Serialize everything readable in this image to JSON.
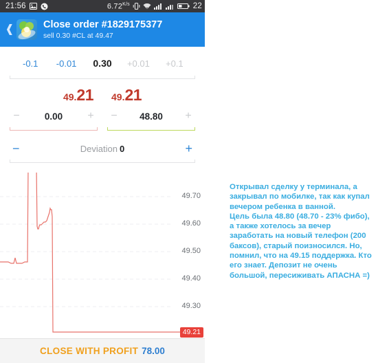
{
  "statusbar": {
    "time": "21:56",
    "icons_left": [
      "photo-icon",
      "phone-clock-icon"
    ],
    "data_rate": "6.72",
    "data_unit": "K/s",
    "icons_right": [
      "vibrate-icon",
      "wifi-icon",
      "signal-icon",
      "signal2-icon",
      "battery-icon"
    ],
    "battery_percent": "22"
  },
  "appbar": {
    "back_icon": "chevron-left-icon",
    "logo_icon": "app-logo-icon",
    "title": "Close order #1829175377",
    "subtitle": "sell 0.30 #CL at 49.47"
  },
  "volume_row": {
    "minus_big": "-0.1",
    "minus_small": "-0.01",
    "value": "0.30",
    "plus_small": "+0.01",
    "plus_big": "+0.1"
  },
  "prices": {
    "bid_int": "49.",
    "bid_dec": "21",
    "ask_int": "49.",
    "ask_dec": "21",
    "color": "#c0392b"
  },
  "steppers": [
    {
      "name": "stop-loss",
      "minus": "−",
      "value": "0.00",
      "plus": "+",
      "underline_color": "#edb7b4"
    },
    {
      "name": "take-profit",
      "minus": "−",
      "value": "48.80",
      "plus": "+",
      "underline_color": "#bcd85c"
    }
  ],
  "deviation": {
    "minus": "−",
    "label": "Deviation",
    "value": "0",
    "plus": "+"
  },
  "chart_data": {
    "type": "line",
    "title": "",
    "xlabel": "",
    "ylabel": "",
    "ylim": [
      49.17,
      49.8
    ],
    "grid": true,
    "line_color": "#e8726a",
    "tick_labels": [
      "49.70",
      "49.60",
      "49.50",
      "49.40",
      "49.30"
    ],
    "tick_values": [
      49.7,
      49.6,
      49.5,
      49.4,
      49.3
    ],
    "last_price_badge": "49.21",
    "last_price": 49.21,
    "series": [
      {
        "name": "#CL price",
        "x": [
          0,
          4,
          8,
          12,
          16,
          20,
          22,
          24,
          26,
          28,
          32,
          36,
          38,
          40,
          41,
          42,
          43,
          44,
          45,
          46,
          47,
          48,
          50,
          52,
          53,
          54,
          55,
          56,
          57,
          58,
          60,
          62,
          64,
          66,
          68,
          70,
          72,
          73,
          74,
          75,
          76,
          77,
          78,
          100,
          150,
          200,
          250,
          283
        ],
        "values": [
          49.46,
          49.46,
          49.46,
          49.46,
          49.455,
          49.455,
          49.47,
          49.455,
          49.455,
          49.455,
          49.455,
          49.46,
          49.46,
          49.46,
          49.7,
          49.78,
          49.78,
          49.78,
          49.79,
          49.795,
          49.78,
          49.785,
          49.785,
          49.785,
          49.78,
          49.6,
          49.59,
          49.59,
          49.6,
          49.605,
          49.605,
          49.61,
          49.615,
          49.615,
          49.62,
          49.63,
          49.645,
          49.66,
          49.655,
          49.655,
          49.63,
          49.21,
          49.21,
          49.21,
          49.21,
          49.21,
          49.21,
          49.21
        ]
      }
    ]
  },
  "bottom_button": {
    "label": "CLOSE WITH PROFIT",
    "value": "78.00",
    "label_color": "#f0a01e",
    "value_color": "#2f7fd0"
  },
  "annotation": {
    "color": "#3aade0",
    "paragraphs": [
      "Открывал сделку у терминала, а закрывал по мобилке, так как купал вечером ребенка в ванной.",
      "Цель была 48.80 (48.70 - 23% фибо), а также хотелось за вечер заработать на новый телефон (200 баксов), старый поизносился. Но, помнил, что на 49.15 поддержка. Кто его знает. Депозит не очень большой, пересиживать АПАСНА =)"
    ]
  }
}
